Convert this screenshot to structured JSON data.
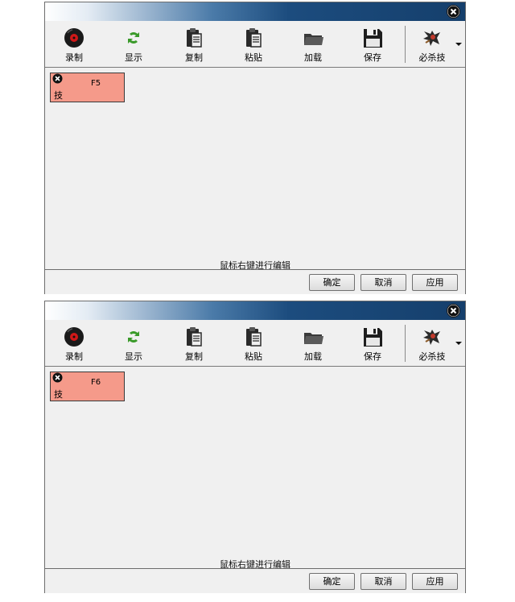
{
  "windows": [
    {
      "toolbar": [
        {
          "label": "录制",
          "icon": "record-disc-icon"
        },
        {
          "label": "显示",
          "icon": "refresh-arrows-icon"
        },
        {
          "label": "复制",
          "icon": "clipboard-icon"
        },
        {
          "label": "粘贴",
          "icon": "paste-clipboard-icon"
        },
        {
          "label": "加载",
          "icon": "folder-icon"
        },
        {
          "label": "保存",
          "icon": "floppy-disk-icon"
        },
        {
          "label": "必杀技",
          "icon": "special-move-icon"
        }
      ],
      "key_item": {
        "name": "技",
        "key": "F5",
        "color": "#f59a8a"
      },
      "hint": "鼠标右键进行编辑",
      "buttons": {
        "ok": "确定",
        "cancel": "取消",
        "apply": "应用"
      }
    },
    {
      "toolbar": [
        {
          "label": "录制",
          "icon": "record-disc-icon"
        },
        {
          "label": "显示",
          "icon": "refresh-arrows-icon"
        },
        {
          "label": "复制",
          "icon": "clipboard-icon"
        },
        {
          "label": "粘贴",
          "icon": "paste-clipboard-icon"
        },
        {
          "label": "加载",
          "icon": "folder-icon"
        },
        {
          "label": "保存",
          "icon": "floppy-disk-icon"
        },
        {
          "label": "必杀技",
          "icon": "special-move-icon"
        }
      ],
      "key_item": {
        "name": "技",
        "key": "F6",
        "color": "#f59a8a"
      },
      "hint": "鼠标右键进行编辑",
      "buttons": {
        "ok": "确定",
        "cancel": "取消",
        "apply": "应用"
      }
    }
  ]
}
